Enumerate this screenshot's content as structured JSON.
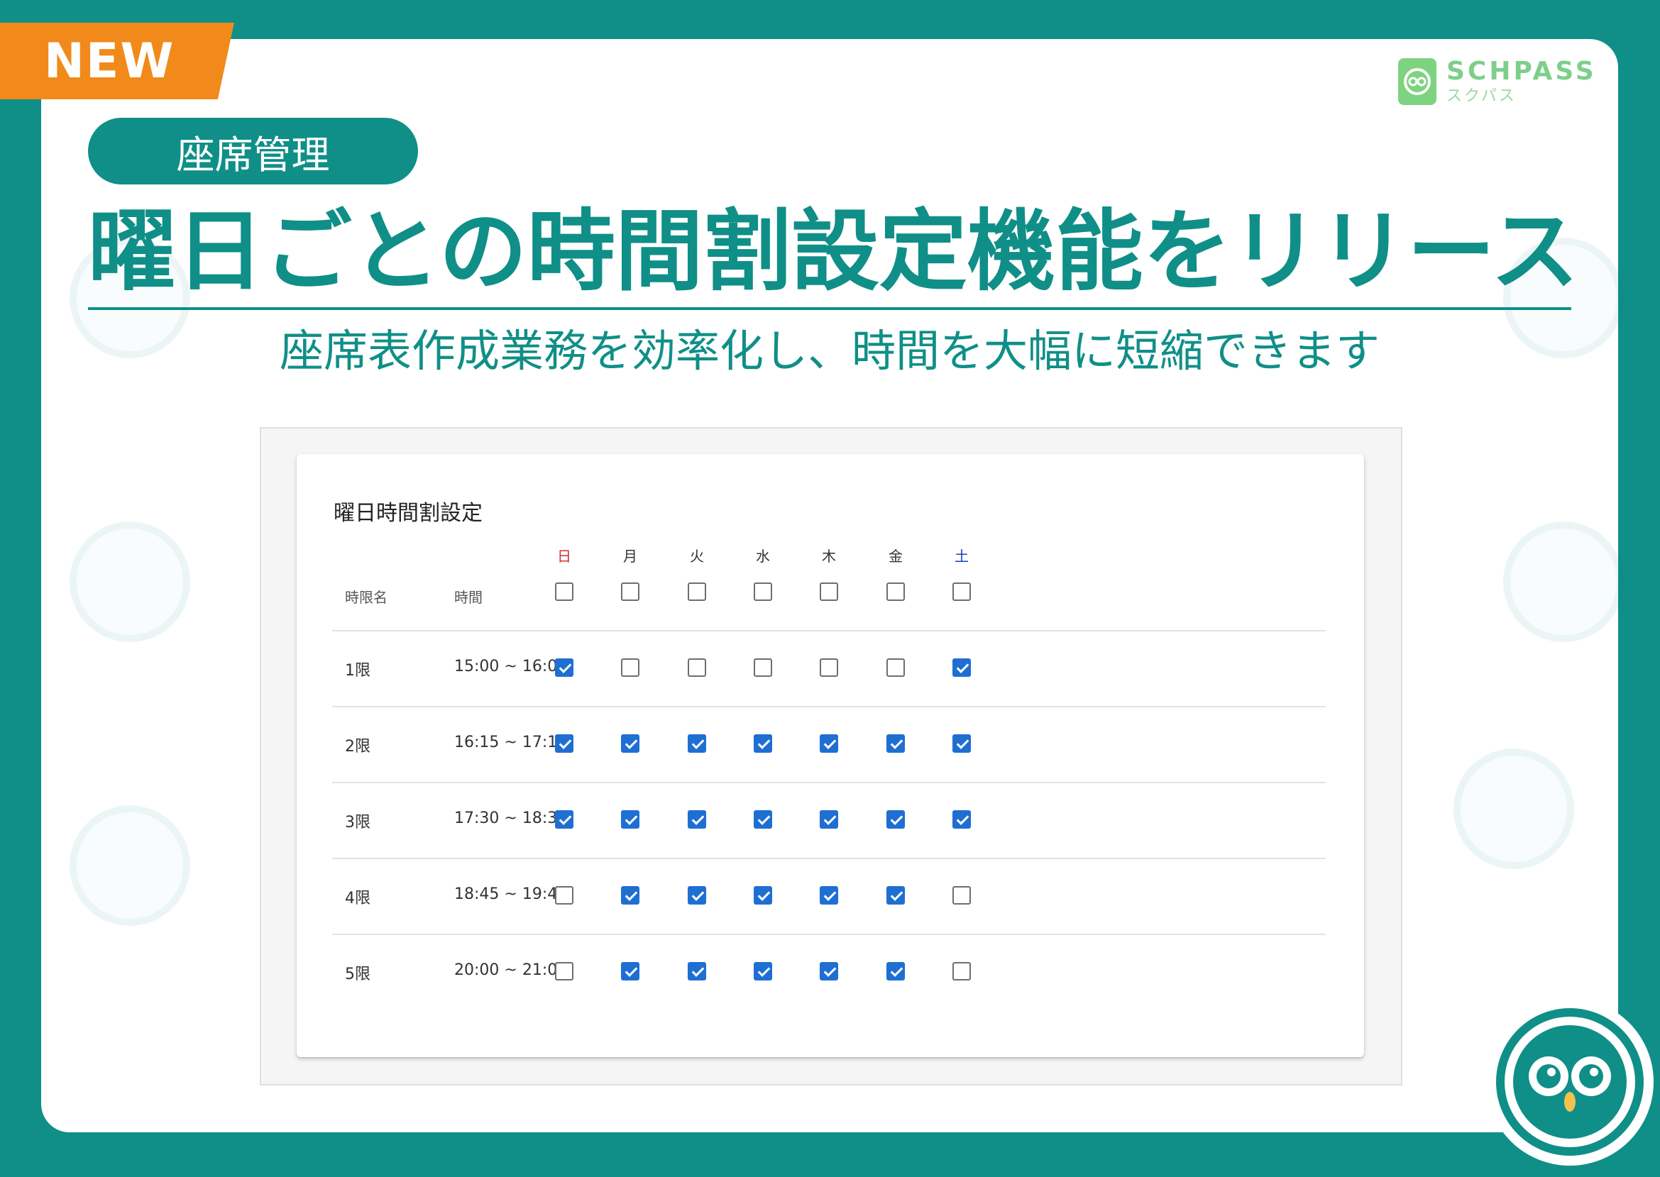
{
  "banner": {
    "badge": "NEW"
  },
  "brand": {
    "name_en": "SCHPASS",
    "name_ja": "スクパス"
  },
  "category": "座席管理",
  "headline": "曜日ごとの時間割設定機能をリリース",
  "subheadline": "座席表作成業務を効率化し、時間を大幅に短縮できます",
  "colors": {
    "brand": "#0f8f87",
    "accent": "#f18a1b",
    "checkbox": "#1f6fd3",
    "sunday": "#d32f2f",
    "saturday": "#1a3fc0"
  },
  "screen": {
    "title": "曜日時間割設定",
    "headers": {
      "period": "時限名",
      "time": "時間"
    },
    "days": [
      "日",
      "月",
      "火",
      "水",
      "木",
      "金",
      "土"
    ],
    "header_checks": [
      false,
      false,
      false,
      false,
      false,
      false,
      false
    ],
    "rows": [
      {
        "name": "1限",
        "time": "15:00 ~ 16:00",
        "checks": [
          true,
          false,
          false,
          false,
          false,
          false,
          true
        ]
      },
      {
        "name": "2限",
        "time": "16:15 ~ 17:15",
        "checks": [
          true,
          true,
          true,
          true,
          true,
          true,
          true
        ]
      },
      {
        "name": "3限",
        "time": "17:30 ~ 18:30",
        "checks": [
          true,
          true,
          true,
          true,
          true,
          true,
          true
        ]
      },
      {
        "name": "4限",
        "time": "18:45 ~ 19:45",
        "checks": [
          false,
          true,
          true,
          true,
          true,
          true,
          false
        ]
      },
      {
        "name": "5限",
        "time": "20:00 ~ 21:00",
        "checks": [
          false,
          true,
          true,
          true,
          true,
          true,
          false
        ]
      }
    ]
  }
}
